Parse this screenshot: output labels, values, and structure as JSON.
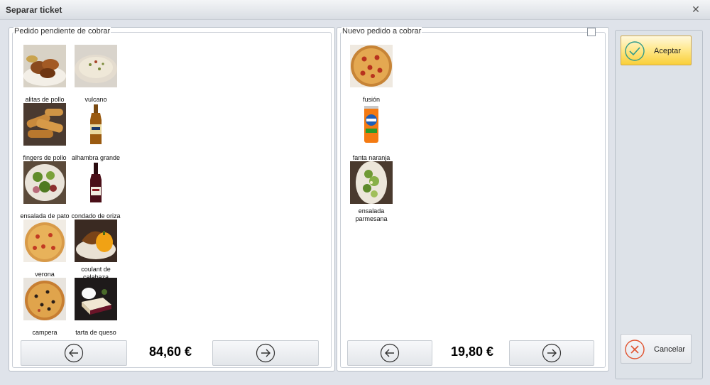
{
  "window": {
    "title": "Separar ticket"
  },
  "left": {
    "label": "Pedido pendiente de cobrar",
    "total": "84,60 €",
    "items": [
      {
        "name": "alitas de pollo"
      },
      {
        "name": "vulcano"
      },
      {
        "name": "fingers de pollo"
      },
      {
        "name": "alhambra grande"
      },
      {
        "name": "ensalada de pato"
      },
      {
        "name": "condado de oriza"
      },
      {
        "name": "verona"
      },
      {
        "name": "coulant de calabaza"
      },
      {
        "name": "campera"
      },
      {
        "name": "tarta de queso"
      }
    ]
  },
  "right": {
    "label": "Nuevo pedido a cobrar",
    "total": "19,80 €",
    "items": [
      {
        "name": "fusión"
      },
      {
        "name": "fanta naranja"
      },
      {
        "name": "ensalada parmesana"
      }
    ]
  },
  "actions": {
    "accept_label": "Aceptar",
    "cancel_label": "Cancelar"
  },
  "colors": {
    "accent": "#f9cf39",
    "accept_icon": "#2f9a8c",
    "cancel_icon": "#e0522e"
  }
}
